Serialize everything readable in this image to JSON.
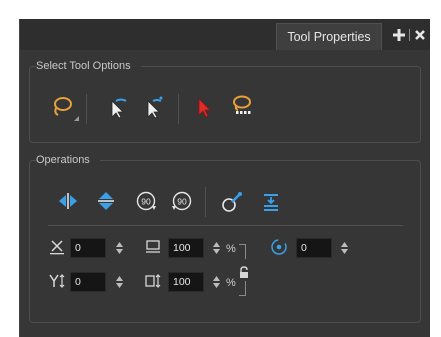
{
  "panel": {
    "tab_title": "Tool Properties",
    "add_icon": "plus-icon",
    "close_icon": "close-icon"
  },
  "select_tool_options": {
    "title": "Select Tool Options",
    "icons": [
      "lasso-icon",
      "select-by-color-icon",
      "select-by-color-permanent-icon",
      "apply-to-all-icon",
      "contour-editor-lasso-icon"
    ]
  },
  "operations": {
    "title": "Operations",
    "icons": [
      "flip-horizontal-icon",
      "flip-vertical-icon",
      "rotate-90-cw-icon",
      "rotate-90-ccw-icon",
      "smooth-icon",
      "flatten-icon"
    ],
    "x_value": "0",
    "y_value": "0",
    "width_value": "100",
    "height_value": "100",
    "width_unit": "%",
    "height_unit": "%",
    "angle_value": "0"
  },
  "colors": {
    "panel_bg": "#363636",
    "accent_orange": "#e8a13a",
    "accent_blue": "#3aa0e8",
    "accent_red": "#e02b2b"
  }
}
